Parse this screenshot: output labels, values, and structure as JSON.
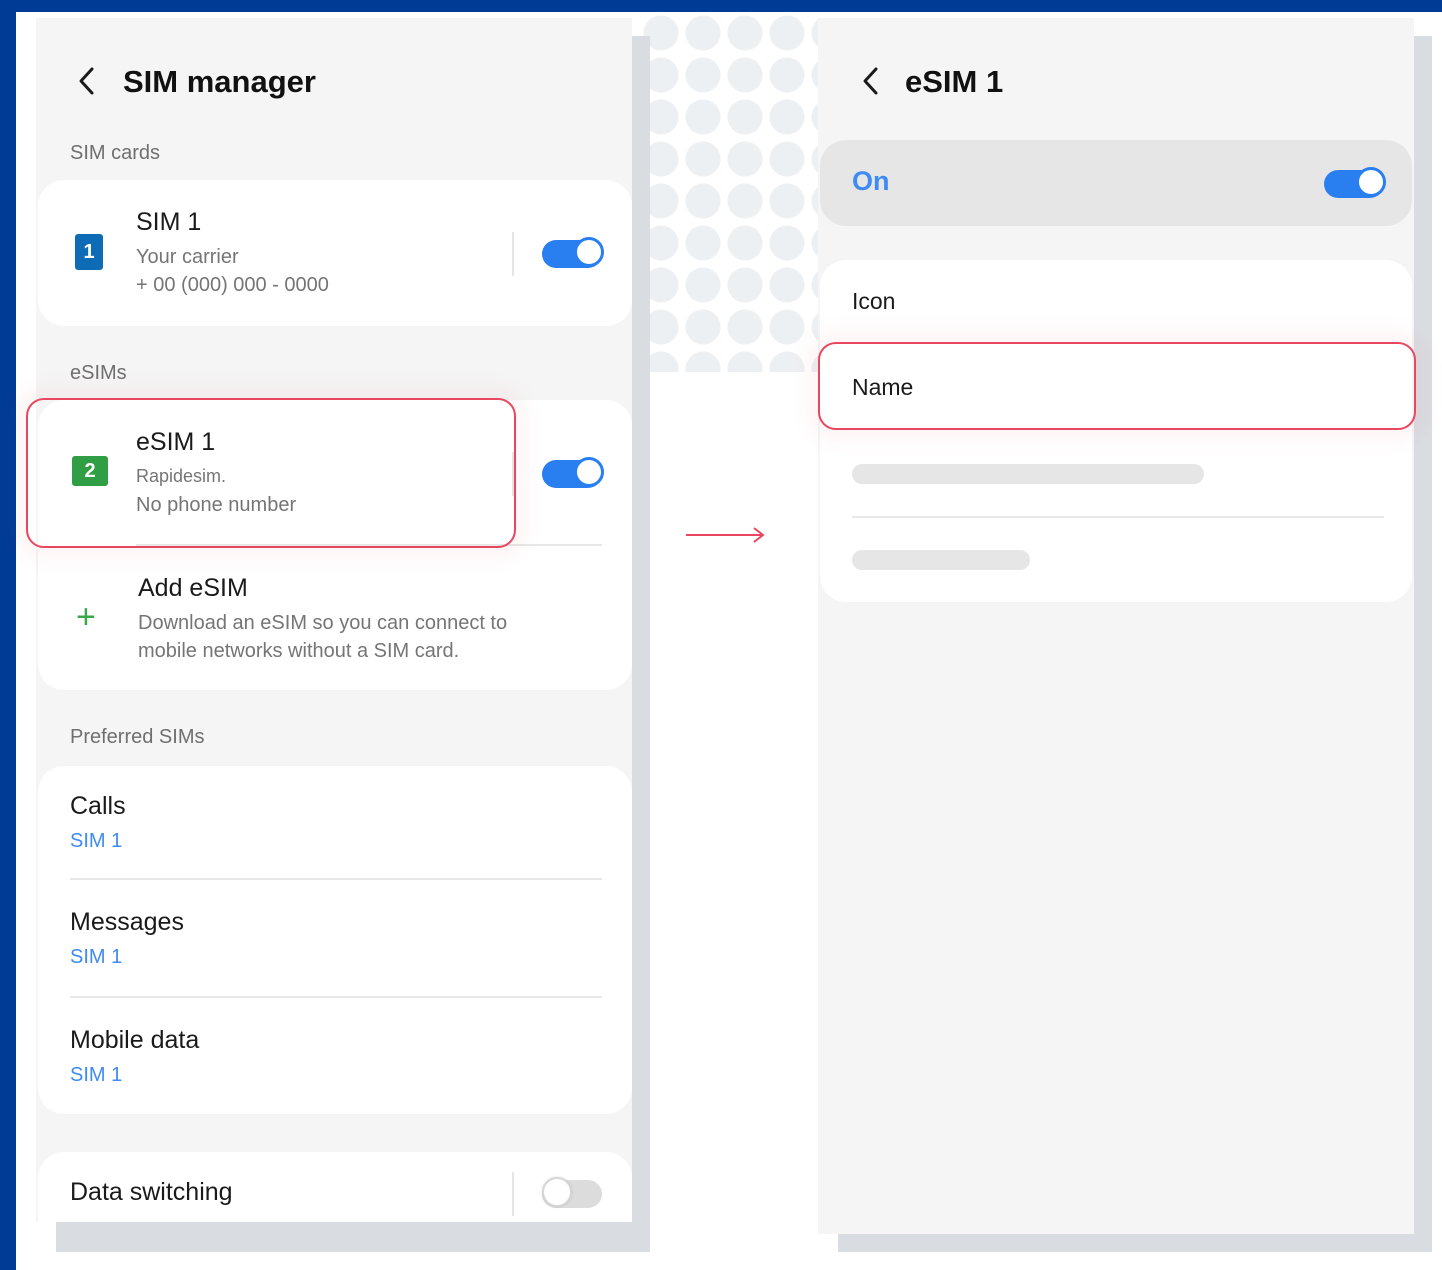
{
  "colors": {
    "frame": "#003c96",
    "accent_blue": "#2a7ff0",
    "link_blue": "#3e8bf3",
    "highlight_red": "#e8475f",
    "sim1_icon": "#0e6cb6",
    "esim_icon": "#2f9e44"
  },
  "left_screen": {
    "back_icon": "chevron-left-icon",
    "title": "SIM manager",
    "sim_cards_label": "SIM cards",
    "sim1": {
      "icon_number": "1",
      "title": "SIM 1",
      "carrier": "Your carrier",
      "number": "+ 00 (000) 000 - 0000",
      "toggle_on": true
    },
    "esims_label": "eSIMs",
    "esim1": {
      "icon_number": "2",
      "title": "eSIM 1",
      "carrier": "Rapidesim.",
      "number": "No phone number",
      "toggle_on": true
    },
    "add_esim": {
      "icon": "plus-icon",
      "title": "Add eSIM",
      "desc_line1": "Download an eSIM so you can connect to",
      "desc_line2": "mobile networks without a SIM card."
    },
    "preferred_label": "Preferred SIMs",
    "preferred": [
      {
        "title": "Calls",
        "value": "SIM 1"
      },
      {
        "title": "Messages",
        "value": "SIM 1"
      },
      {
        "title": "Mobile data",
        "value": "SIM 1"
      }
    ],
    "data_switching": {
      "title": "Data switching",
      "toggle_on": false
    }
  },
  "arrow_icon": "arrow-right-icon",
  "right_screen": {
    "back_icon": "chevron-left-icon",
    "title": "eSIM 1",
    "on_label": "On",
    "toggle_on": true,
    "icon_row": "Icon",
    "name_row": "Name"
  }
}
